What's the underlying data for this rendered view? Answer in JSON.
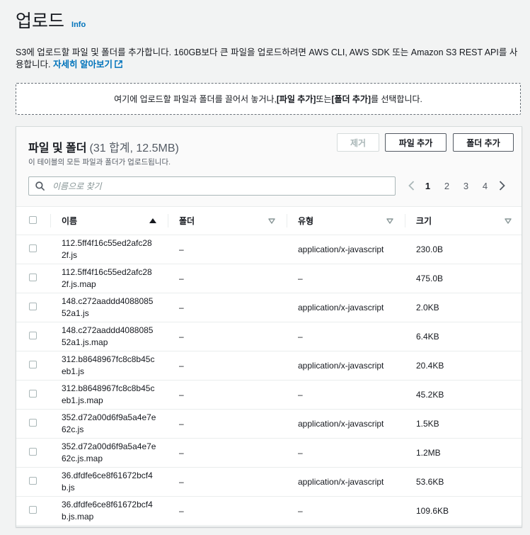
{
  "header": {
    "title": "업로드",
    "info": "Info"
  },
  "description": {
    "text": "S3에 업로드할 파일 및 폴더를 추가합니다. 160GB보다 큰 파일을 업로드하려면 AWS CLI, AWS SDK 또는 Amazon S3 REST API를 사용합니다.",
    "learn_more": "자세히 알아보기"
  },
  "dropzone": {
    "prefix": "여기에 업로드할 파일과 폴더를 끌어서 놓거나, ",
    "add_files": "[파일 추가]",
    "middle": " 또는 ",
    "add_folder": "[폴더 추가]",
    "suffix": "를 선택합니다."
  },
  "panel": {
    "title": "파일 및 폴더",
    "count": "(31 합계, 12.5MB)",
    "subtitle": "이 테이블의 모든 파일과 폴더가 업로드됩니다.",
    "remove_label": "제거",
    "add_files_label": "파일 추가",
    "add_folder_label": "폴더 추가",
    "search_placeholder": "이름으로 찾기"
  },
  "pagination": {
    "pages": [
      "1",
      "2",
      "3",
      "4"
    ],
    "current": "1"
  },
  "table": {
    "columns": [
      "이름",
      "폴더",
      "유형",
      "크기"
    ],
    "rows": [
      {
        "name": "112.5ff4f16c55ed2afc282f.js",
        "folder": "–",
        "type": "application/x-javascript",
        "size": "230.0B"
      },
      {
        "name": "112.5ff4f16c55ed2afc282f.js.map",
        "folder": "–",
        "type": "–",
        "size": "475.0B"
      },
      {
        "name": "148.c272aaddd408808552a1.js",
        "folder": "–",
        "type": "application/x-javascript",
        "size": "2.0KB"
      },
      {
        "name": "148.c272aaddd408808552a1.js.map",
        "folder": "–",
        "type": "–",
        "size": "6.4KB"
      },
      {
        "name": "312.b8648967fc8c8b45ceb1.js",
        "folder": "–",
        "type": "application/x-javascript",
        "size": "20.4KB"
      },
      {
        "name": "312.b8648967fc8c8b45ceb1.js.map",
        "folder": "–",
        "type": "–",
        "size": "45.2KB"
      },
      {
        "name": "352.d72a00d6f9a5a4e7e62c.js",
        "folder": "–",
        "type": "application/x-javascript",
        "size": "1.5KB"
      },
      {
        "name": "352.d72a00d6f9a5a4e7e62c.js.map",
        "folder": "–",
        "type": "–",
        "size": "1.2MB"
      },
      {
        "name": "36.dfdfe6ce8f61672bcf4b.js",
        "folder": "–",
        "type": "application/x-javascript",
        "size": "53.6KB"
      },
      {
        "name": "36.dfdfe6ce8f61672bcf4b.js.map",
        "folder": "–",
        "type": "–",
        "size": "109.6KB"
      }
    ]
  },
  "colors": {
    "link": "#0073bb",
    "text": "#16191f",
    "border": "#eaeded",
    "background": "#f2f3f3"
  }
}
